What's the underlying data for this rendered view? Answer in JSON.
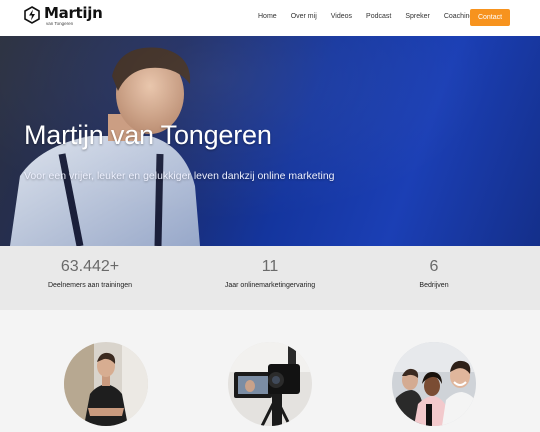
{
  "header": {
    "logo": {
      "name": "Martijn",
      "sub": "van Tongeren",
      "icon": "lightning-hexagon-icon"
    },
    "nav": [
      "Home",
      "Over mij",
      "Videos",
      "Podcast",
      "Spreker",
      "Coaching"
    ],
    "contact_label": "Contact",
    "accent_color": "#f7931e"
  },
  "hero": {
    "title": "Martijn van Tongeren",
    "subtitle": "Voor een vrijer, leuker en gelukkiger leven dankzij online marketing"
  },
  "stats": [
    {
      "number": "63.442+",
      "label": "Deelnemers aan trainingen"
    },
    {
      "number": "11",
      "label": "Jaar onlinemarketingervaring"
    },
    {
      "number": "6",
      "label": "Bedrijven"
    }
  ],
  "photos": [
    {
      "icon": "person-photo"
    },
    {
      "icon": "camera-studio-photo"
    },
    {
      "icon": "group-selfie-photo"
    }
  ]
}
